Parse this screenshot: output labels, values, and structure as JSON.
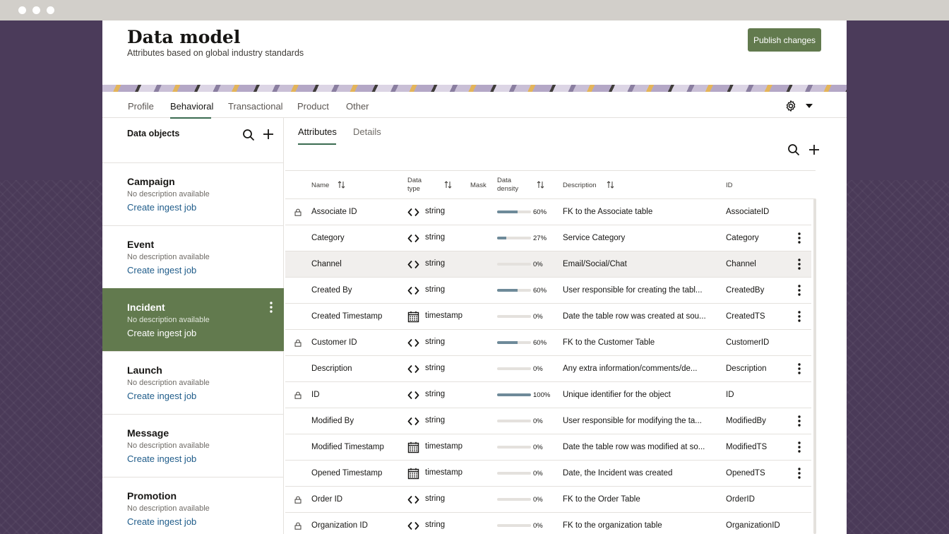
{
  "header": {
    "title": "Data model",
    "subtitle": "Attributes based on global industry standards",
    "publish_label": "Publish changes"
  },
  "top_tabs": [
    "Profile",
    "Behavioral",
    "Transactional",
    "Product",
    "Other"
  ],
  "active_top_tab": "Behavioral",
  "sidebar": {
    "title": "Data objects",
    "objects": [
      {
        "name": "Campaign",
        "desc": "No description available",
        "link": "Create ingest job"
      },
      {
        "name": "Event",
        "desc": "No description available",
        "link": "Create ingest job"
      },
      {
        "name": "Incident",
        "desc": "No description available",
        "link": "Create ingest job",
        "selected": true
      },
      {
        "name": "Launch",
        "desc": "No description available",
        "link": "Create ingest job"
      },
      {
        "name": "Message",
        "desc": "No description available",
        "link": "Create ingest job"
      },
      {
        "name": "Promotion",
        "desc": "No description available",
        "link": "Create ingest job"
      }
    ]
  },
  "inner_tabs": [
    "Attributes",
    "Details"
  ],
  "active_inner_tab": "Attributes",
  "table": {
    "columns": {
      "name": "Name",
      "type_line1": "Data",
      "type_line2": "type",
      "mask": "Mask",
      "density_line1": "Data",
      "density_line2": "density",
      "description": "Description",
      "id": "ID"
    },
    "rows": [
      {
        "name": "Associate ID",
        "type": "string",
        "icon": "code-icon",
        "density": 60,
        "pct": "60%",
        "desc": "FK to the Associate table",
        "id": "AssociateID",
        "locked": true,
        "menu": false
      },
      {
        "name": "Category",
        "type": "string",
        "icon": "code-icon",
        "density": 27,
        "pct": "27%",
        "desc": "Service Category",
        "id": "Category",
        "locked": false,
        "menu": true
      },
      {
        "name": "Channel",
        "type": "string",
        "icon": "code-icon",
        "density": 0,
        "pct": "0%",
        "desc": "Email/Social/Chat",
        "id": "Channel",
        "locked": false,
        "menu": true,
        "highlight": true
      },
      {
        "name": "Created By",
        "type": "string",
        "icon": "code-icon",
        "density": 60,
        "pct": "60%",
        "desc": "User responsible for creating the tabl...",
        "id": "CreatedBy",
        "locked": false,
        "menu": true
      },
      {
        "name": "Created Timestamp",
        "type": "timestamp",
        "icon": "calendar-icon",
        "density": 0,
        "pct": "0%",
        "desc": "Date the table row was created at sou...",
        "id": "CreatedTS",
        "locked": false,
        "menu": true
      },
      {
        "name": "Customer ID",
        "type": "string",
        "icon": "code-icon",
        "density": 60,
        "pct": "60%",
        "desc": "FK to the Customer Table",
        "id": "CustomerID",
        "locked": true,
        "menu": false
      },
      {
        "name": "Description",
        "type": "string",
        "icon": "code-icon",
        "density": 0,
        "pct": "0%",
        "desc": "Any extra information/comments/de...",
        "id": "Description",
        "locked": false,
        "menu": true
      },
      {
        "name": "ID",
        "type": "string",
        "icon": "code-icon",
        "density": 100,
        "pct": "100%",
        "desc": "Unique identifier for the object",
        "id": "ID",
        "locked": true,
        "menu": false
      },
      {
        "name": "Modified By",
        "type": "string",
        "icon": "code-icon",
        "density": 0,
        "pct": "0%",
        "desc": "User responsible for modifying the ta...",
        "id": "ModifiedBy",
        "locked": false,
        "menu": true
      },
      {
        "name": "Modified Timestamp",
        "type": "timestamp",
        "icon": "calendar-icon",
        "density": 0,
        "pct": "0%",
        "desc": "Date the table row was modified at so...",
        "id": "ModifiedTS",
        "locked": false,
        "menu": true
      },
      {
        "name": "Opened Timestamp",
        "type": "timestamp",
        "icon": "calendar-icon",
        "density": 0,
        "pct": "0%",
        "desc": "Date, the Incident was created",
        "id": "OpenedTS",
        "locked": false,
        "menu": true
      },
      {
        "name": "Order ID",
        "type": "string",
        "icon": "code-icon",
        "density": 0,
        "pct": "0%",
        "desc": "FK to the Order Table",
        "id": "OrderID",
        "locked": true,
        "menu": false
      },
      {
        "name": "Organization ID",
        "type": "string",
        "icon": "code-icon",
        "density": 0,
        "pct": "0%",
        "desc": "FK to the organization table",
        "id": "OrganizationID",
        "locked": true,
        "menu": false
      }
    ]
  },
  "colors": {
    "accent_green": "#627a4e",
    "link_blue": "#1f5c8a",
    "tab_underline": "#3a6b50",
    "density_bar": "#6e8a99",
    "page_background": "#4a3a58"
  }
}
